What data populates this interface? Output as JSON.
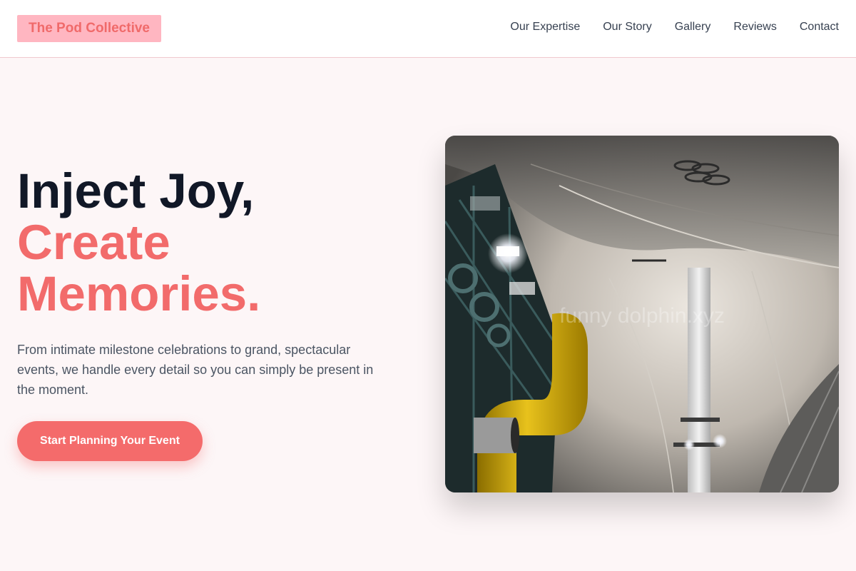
{
  "header": {
    "logo": "The Pod Collective",
    "nav": [
      {
        "label": "Our Expertise"
      },
      {
        "label": "Our Story"
      },
      {
        "label": "Gallery"
      },
      {
        "label": "Reviews"
      },
      {
        "label": "Contact"
      }
    ]
  },
  "hero": {
    "line1": "Inject Joy,",
    "line2": "Create",
    "line3": "Memories.",
    "lead": "From intimate milestone celebrations to grand, spectacular events, we handle every detail so you can simply be present in the moment.",
    "cta": "Start Planning Your Event",
    "image_watermark": "funny dolphin.xyz"
  },
  "colors": {
    "accent": "#f46b6b",
    "logo_bg": "#ffb6c1",
    "page_bg": "#fdf6f7",
    "heading": "#111827"
  }
}
